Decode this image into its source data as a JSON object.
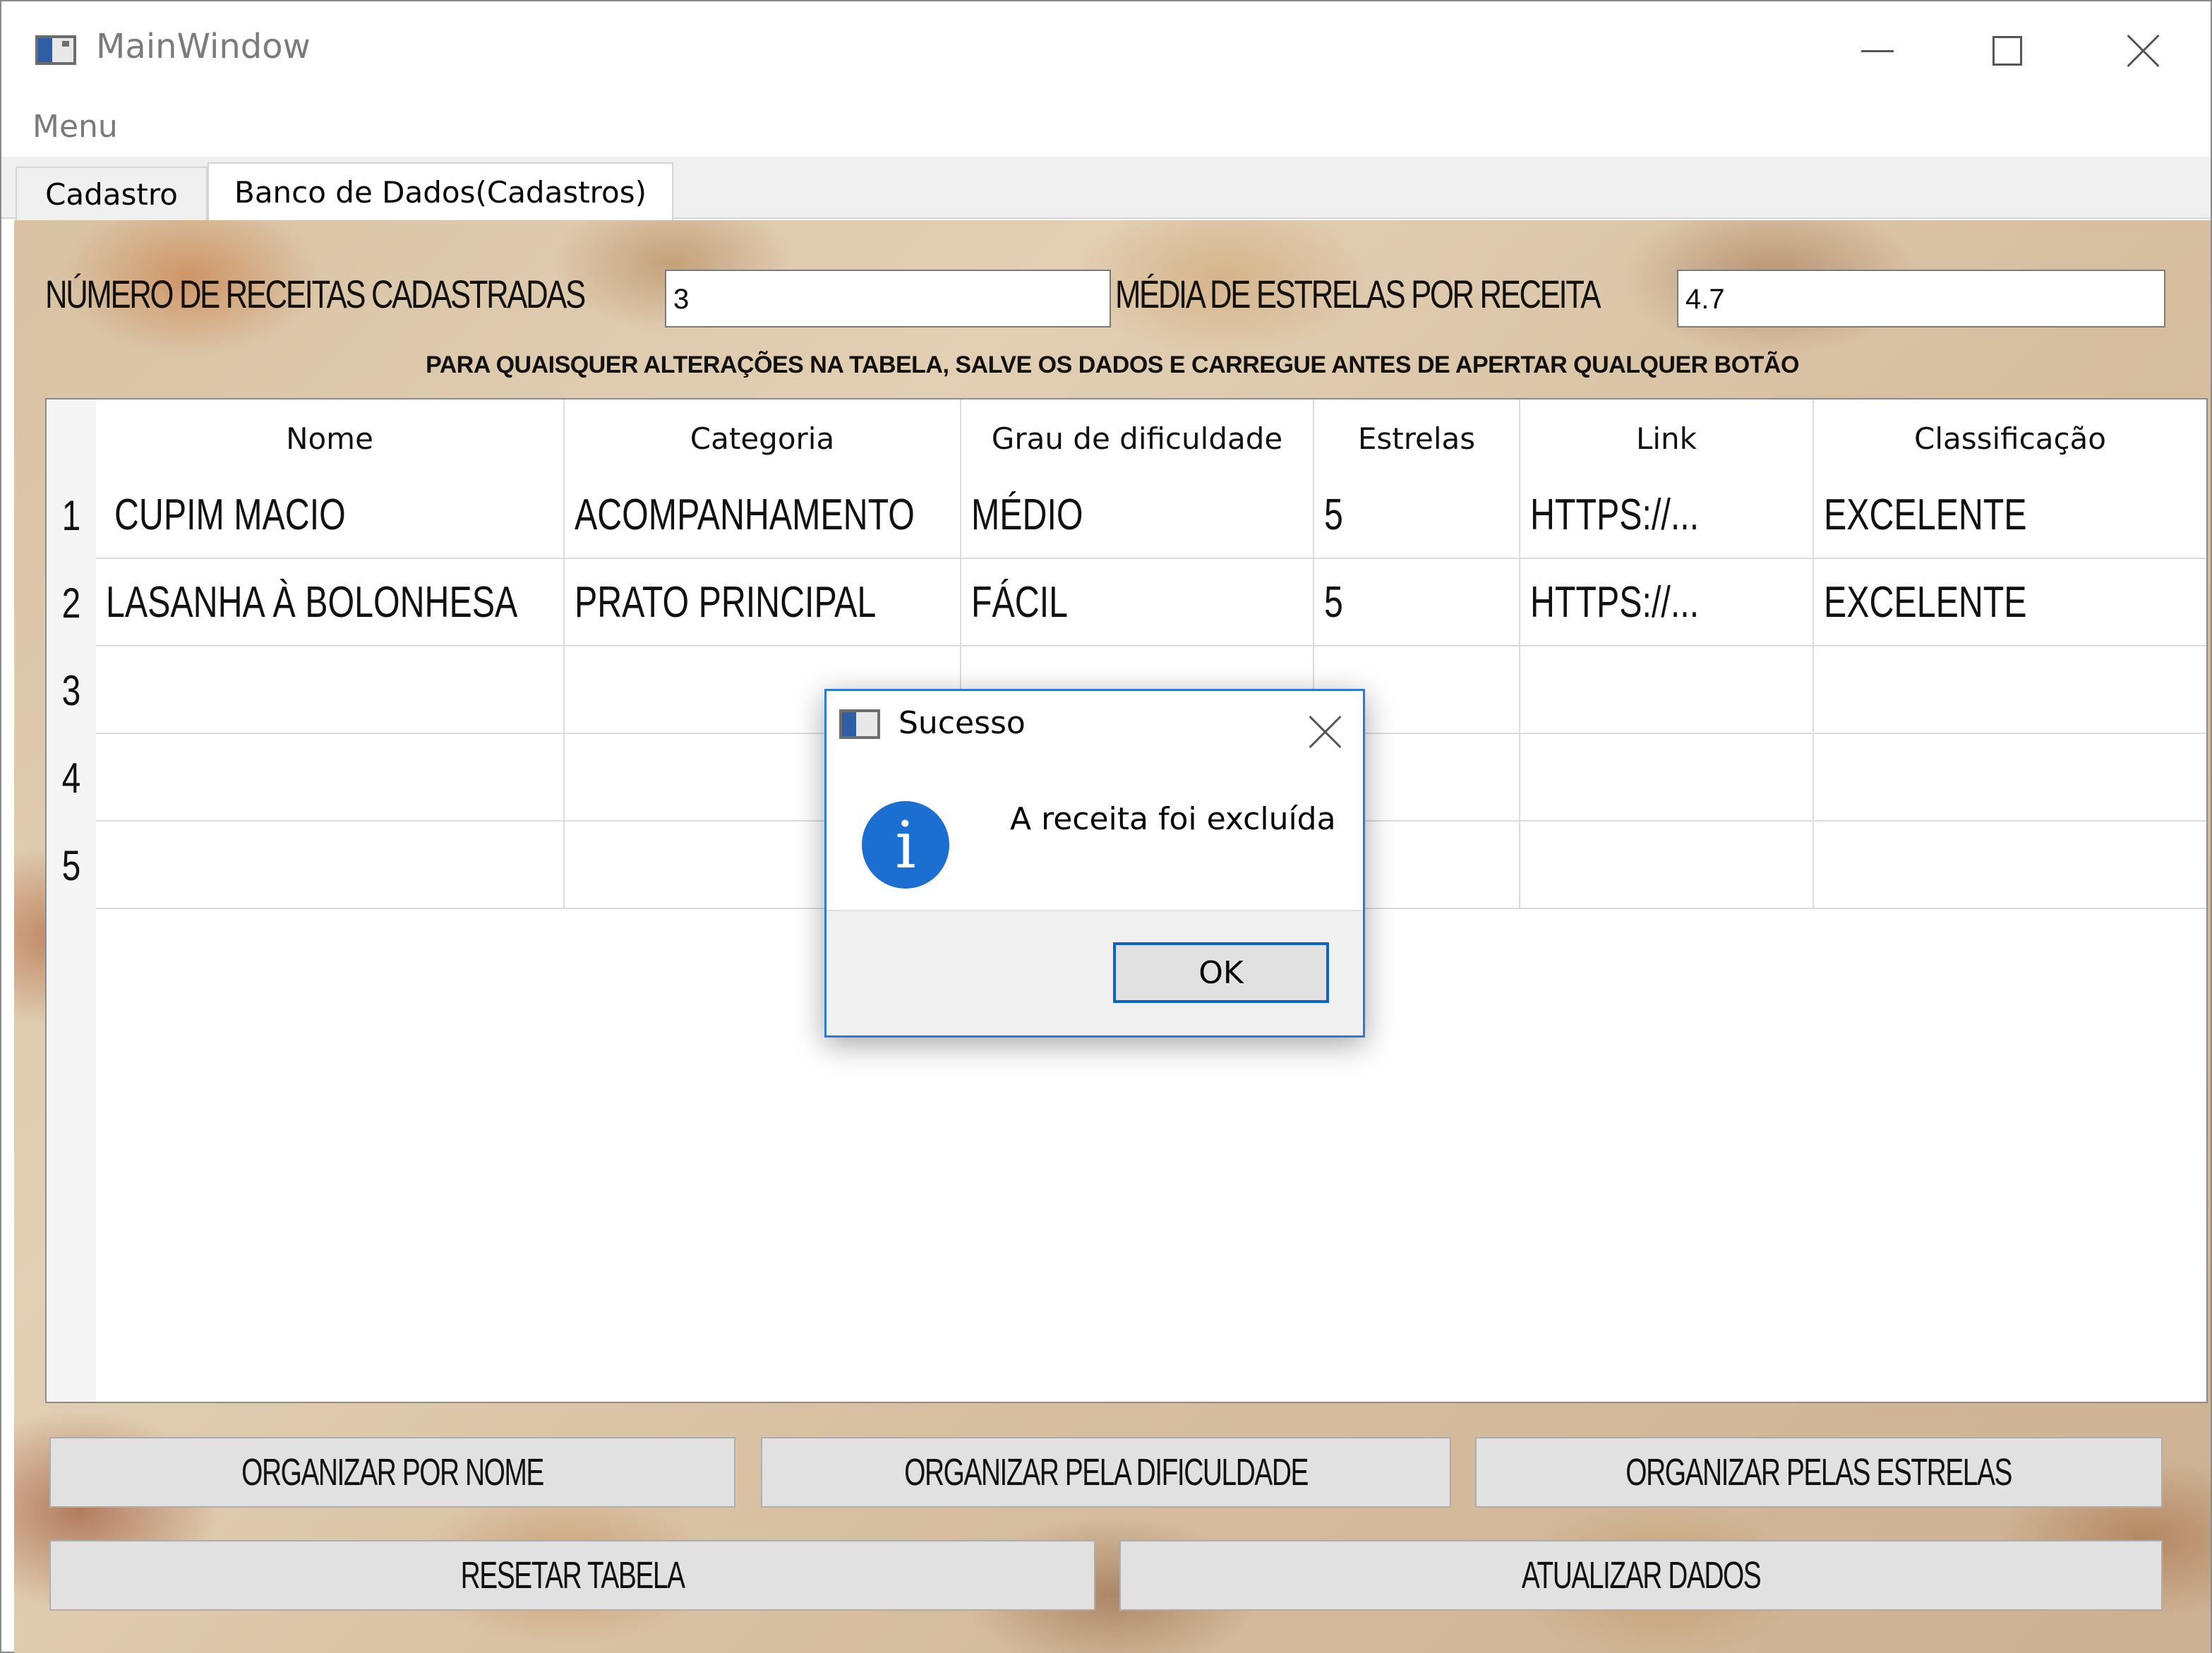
{
  "window": {
    "title": "MainWindow"
  },
  "menu": {
    "label": "Menu"
  },
  "tabs": [
    {
      "label": "Cadastro",
      "active": false
    },
    {
      "label": "Banco de Dados(Cadastros)",
      "active": true
    }
  ],
  "stats": {
    "recipes_label": "NÚMERO DE RECEITAS CADASTRADAS",
    "recipes_value": "3",
    "avg_label": "MÉDIA DE ESTRELAS POR RECEITA",
    "avg_value": "4.7"
  },
  "notice": "PARA QUAISQUER ALTERAÇÕES NA TABELA, SALVE OS DADOS E CARREGUE ANTES DE APERTAR QUALQUER BOTÃO",
  "table": {
    "headers": [
      "Nome",
      "Categoria",
      "Grau de dificuldade",
      "Estrelas",
      "Link",
      "Classificação"
    ],
    "row_numbers": [
      "1",
      "2",
      "3",
      "4",
      "5"
    ],
    "rows": [
      [
        "CUPIM MACIO",
        "ACOMPANHAMENTO",
        "MÉDIO",
        "5",
        "HTTPS://...",
        "EXCELENTE"
      ],
      [
        "LASANHA À BOLONHESA",
        "PRATO PRINCIPAL",
        "FÁCIL",
        "5",
        "HTTPS://...",
        "EXCELENTE"
      ],
      [
        "",
        "",
        "",
        "",
        "",
        ""
      ],
      [
        "",
        "",
        "",
        "",
        "",
        ""
      ],
      [
        "",
        "",
        "",
        "",
        "",
        ""
      ]
    ]
  },
  "buttons": {
    "sort_name": "ORGANIZAR POR NOME",
    "sort_difficulty": "ORGANIZAR PELA DIFICULDADE",
    "sort_stars": "ORGANIZAR PELAS ESTRELAS",
    "reset": "RESETAR TABELA",
    "update": "ATUALIZAR DADOS"
  },
  "dialog": {
    "title": "Sucesso",
    "message": "A receita foi excluída",
    "ok": "OK",
    "icon": "info-icon"
  },
  "colors": {
    "dialog_border": "#2b79d8",
    "info_icon": "#1a6fd0",
    "ok_focus": "#0a64cc"
  }
}
